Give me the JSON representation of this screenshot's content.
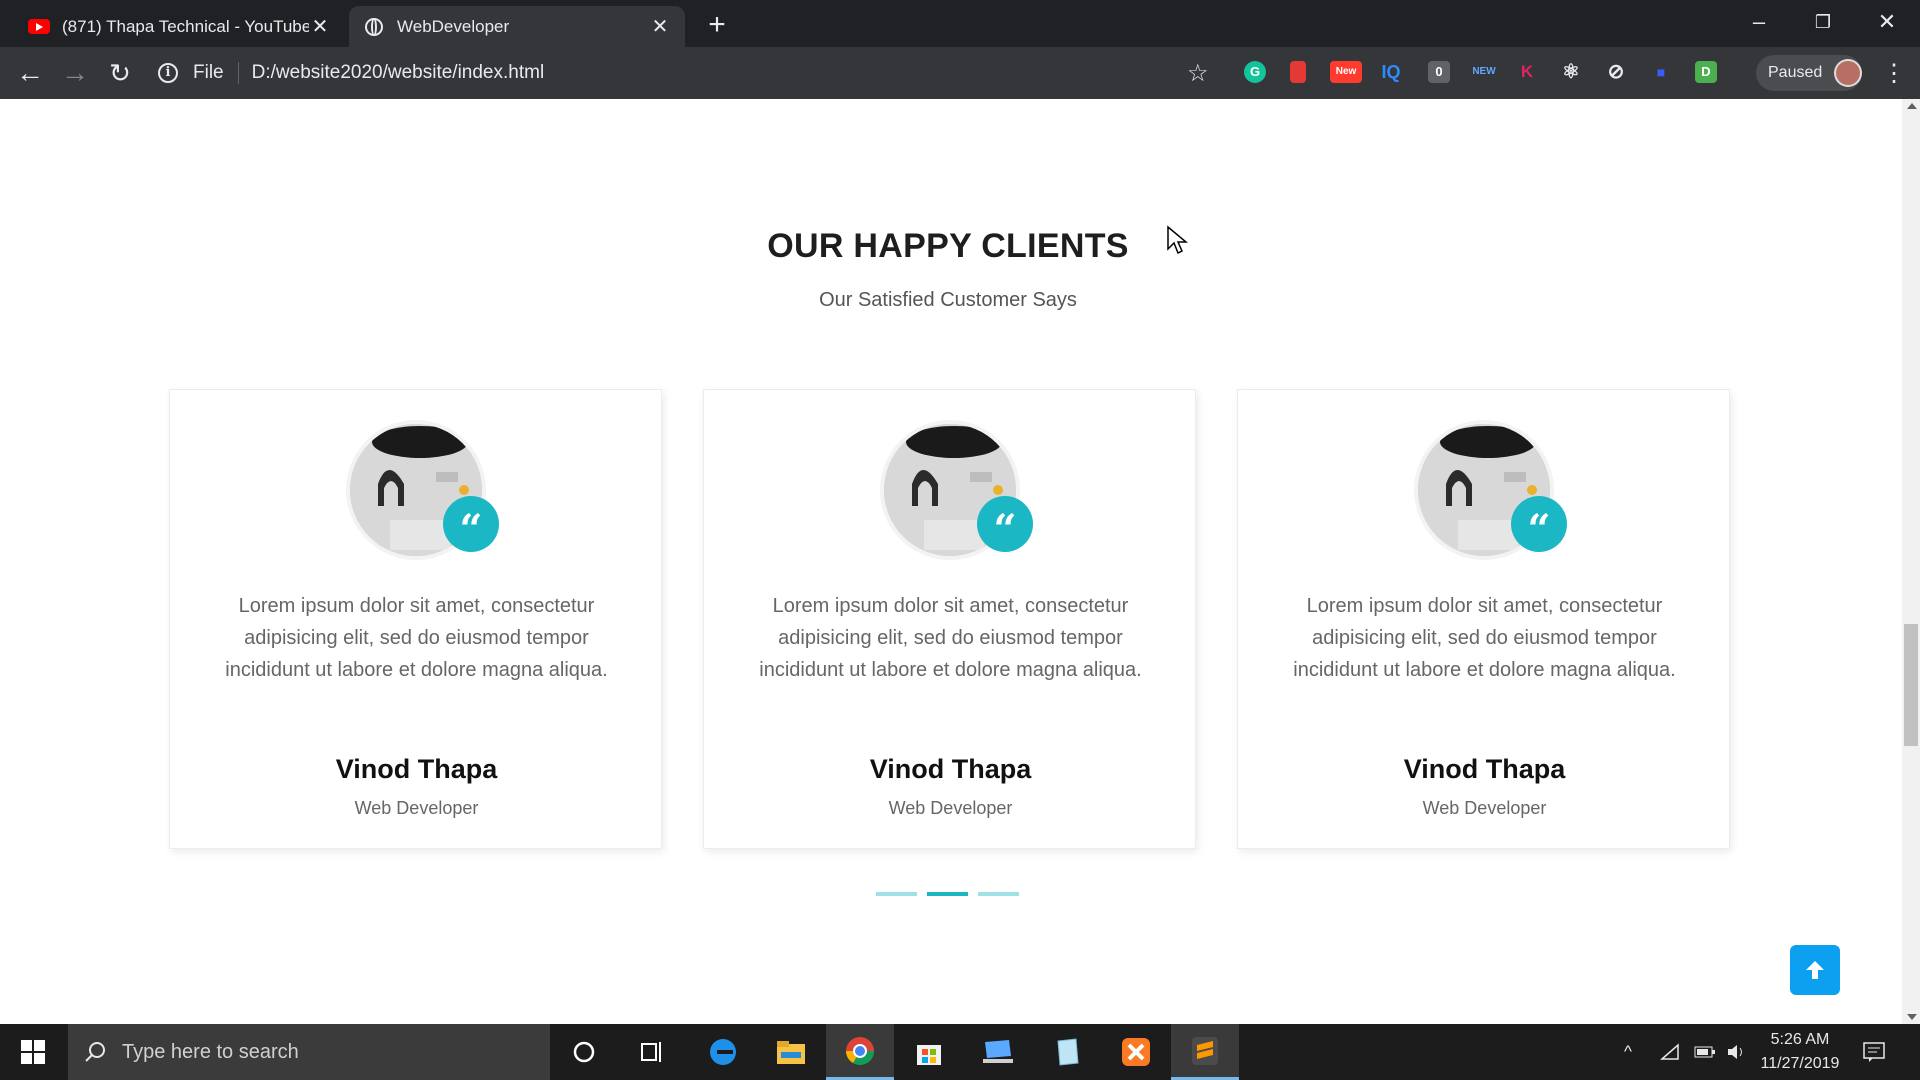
{
  "browser": {
    "tabs": [
      {
        "title": "(871) Thapa Technical - YouTube",
        "favicon": "youtube-icon",
        "active": false
      },
      {
        "title": "WebDeveloper",
        "favicon": "globe-icon",
        "active": true
      }
    ],
    "address_scheme": "File",
    "address_url": "D:/website2020/website/index.html",
    "profile_status": "Paused",
    "extensions": [
      {
        "name": "grammarly-icon",
        "color": "#15c39a",
        "label": "G"
      },
      {
        "name": "bookmark-red-icon",
        "color": "#e53935",
        "label": ""
      },
      {
        "name": "new-badge-icon",
        "color": "#ff3b30",
        "label": "New"
      },
      {
        "name": "iq-icon",
        "color": "#2d8cff",
        "label": "IQ"
      },
      {
        "name": "counter-icon",
        "color": "#6b6b6b",
        "label": "0"
      },
      {
        "name": "new-extension-icon",
        "color": "#1f6fde",
        "label": "NEW"
      },
      {
        "name": "k-icon",
        "color": "#e0245e",
        "label": "K"
      },
      {
        "name": "react-icon",
        "color": "#9aa0a6",
        "label": "⚛"
      },
      {
        "name": "compass-icon",
        "color": "#e8eaed",
        "label": "⊘"
      },
      {
        "name": "blue-square-icon",
        "color": "#3b5bff",
        "label": "■"
      },
      {
        "name": "d-icon",
        "color": "#4caf50",
        "label": "D"
      }
    ]
  },
  "section": {
    "title": "OUR HAPPY CLIENTS",
    "subtitle": "Our Satisfied Customer Says"
  },
  "testimonials": [
    {
      "text": "Lorem ipsum dolor sit amet, consectetur adipisicing elit, sed do eiusmod tempor incididunt ut labore et dolore magna aliqua.",
      "name": "Vinod Thapa",
      "role": "Web Developer"
    },
    {
      "text": "Lorem ipsum dolor sit amet, consectetur adipisicing elit, sed do eiusmod tempor incididunt ut labore et dolore magna aliqua.",
      "name": "Vinod Thapa",
      "role": "Web Developer"
    },
    {
      "text": "Lorem ipsum dolor sit amet, consectetur adipisicing elit, sed do eiusmod tempor incididunt ut labore et dolore magna aliqua.",
      "name": "Vinod Thapa",
      "role": "Web Developer"
    }
  ],
  "carousel": {
    "active_index": 1,
    "page_count": 3
  },
  "colors": {
    "accent": "#1cb7c4",
    "to_top_button": "#0ea0f0"
  },
  "taskbar": {
    "search_placeholder": "Type here to search",
    "time": "5:26 AM",
    "date": "11/27/2019"
  }
}
